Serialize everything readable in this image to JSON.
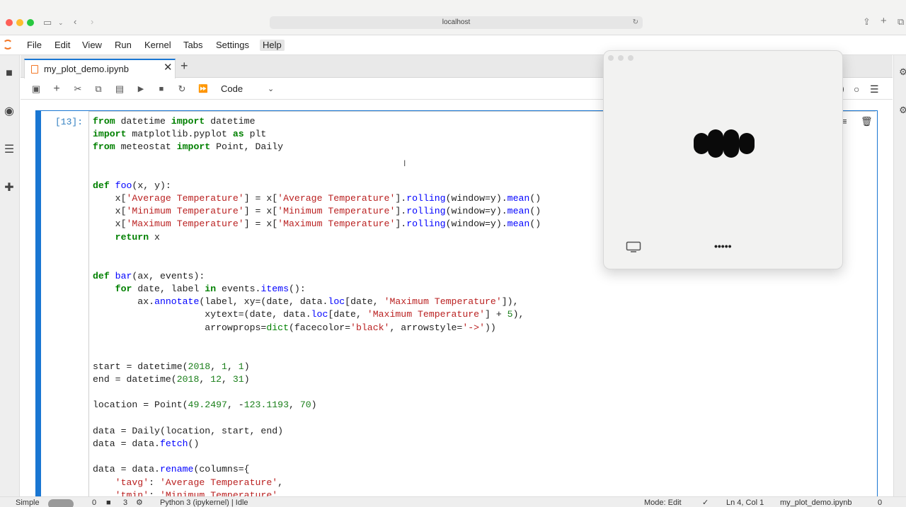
{
  "browser": {
    "url": "localhost"
  },
  "menu": {
    "items": [
      "File",
      "Edit",
      "View",
      "Run",
      "Kernel",
      "Tabs",
      "Settings",
      "Help"
    ]
  },
  "tab": {
    "title": "my_plot_demo.ipynb"
  },
  "toolbar": {
    "cell_type": "Code"
  },
  "cell": {
    "prompt": "[13]:",
    "lines": [
      "from datetime import datetime",
      "import matplotlib.pyplot as plt",
      "from meteostat import Point, Daily",
      "",
      "",
      "def foo(x, y):",
      "    x['Average Temperature'] = x['Average Temperature'].rolling(window=y).mean()",
      "    x['Minimum Temperature'] = x['Minimum Temperature'].rolling(window=y).mean()",
      "    x['Maximum Temperature'] = x['Maximum Temperature'].rolling(window=y).mean()",
      "    return x",
      "",
      "",
      "def bar(ax, events):",
      "    for date, label in events.items():",
      "        ax.annotate(label, xy=(date, data.loc[date, 'Maximum Temperature']),",
      "                    xytext=(date, data.loc[date, 'Maximum Temperature'] + 5),",
      "                    arrowprops=dict(facecolor='black', arrowstyle='->'))",
      "",
      "",
      "start = datetime(2018, 1, 1)",
      "end = datetime(2018, 12, 31)",
      "",
      "location = Point(49.2497, -123.1193, 70)",
      "",
      "data = Daily(location, start, end)",
      "data = data.fetch()",
      "",
      "data = data.rename(columns={",
      "    'tavg': 'Average Temperature',",
      "    'tmin': 'Minimum Temperature',"
    ]
  },
  "status": {
    "mode_label": "Simple",
    "count_a": "0",
    "count_b": "3",
    "kernel": "Python 3 (ipykernel) | Idle",
    "mode": "Mode: Edit",
    "position": "Ln 4, Col 1",
    "file": "my_plot_demo.ipynb",
    "notifications": "0"
  },
  "overlay": {
    "dots": "•••••"
  },
  "colors": {
    "accent": "#1976d2",
    "jupyter_orange": "#f37726"
  }
}
